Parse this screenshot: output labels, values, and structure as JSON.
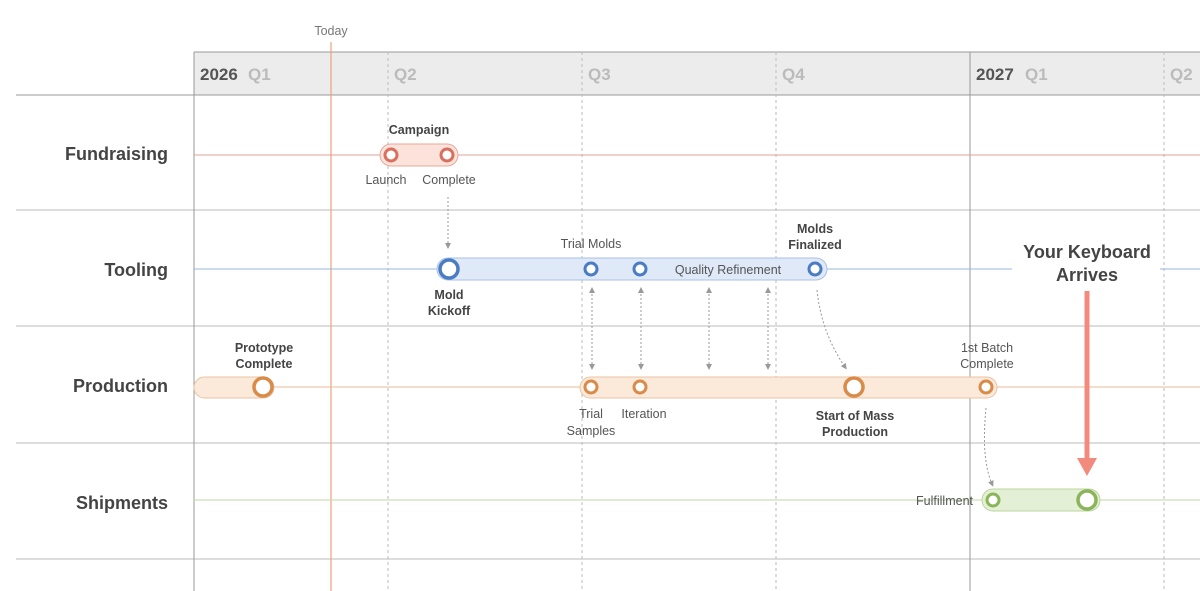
{
  "today": {
    "label": "Today"
  },
  "header": {
    "quarters": [
      {
        "year": "2026",
        "quarter": "Q1"
      },
      {
        "year": "",
        "quarter": "Q2"
      },
      {
        "year": "",
        "quarter": "Q3"
      },
      {
        "year": "",
        "quarter": "Q4"
      },
      {
        "year": "2027",
        "quarter": "Q1"
      },
      {
        "year": "",
        "quarter": "Q2"
      }
    ]
  },
  "lanes": [
    {
      "label": "Fundraising",
      "color": "#d9705e"
    },
    {
      "label": "Tooling",
      "color": "#4a7cc4"
    },
    {
      "label": "Production",
      "color": "#d98b4a"
    },
    {
      "label": "Shipments",
      "color": "#8bb55a"
    }
  ],
  "annotations": {
    "campaign": "Campaign",
    "launch": "Launch",
    "complete": "Complete",
    "trial_molds": "Trial Molds",
    "molds_finalized_1": "Molds",
    "molds_finalized_2": "Finalized",
    "mold_kickoff_1": "Mold",
    "mold_kickoff_2": "Kickoff",
    "quality_refinement": "Quality Refinement",
    "prototype_1": "Prototype",
    "prototype_2": "Complete",
    "first_batch_1": "1st Batch",
    "first_batch_2": "Complete",
    "trial_samples_1": "Trial",
    "trial_samples_2": "Samples",
    "iteration": "Iteration",
    "mass_production_1": "Start of Mass",
    "mass_production_2": "Production",
    "fulfillment": "Fulfillment",
    "keyboard_1": "Your Keyboard",
    "keyboard_2": "Arrives"
  },
  "colors": {
    "accent_arrow": "#f28b7e",
    "grid": "#cccccc",
    "header_bg": "#ececec",
    "today_line": "#e8a37a"
  }
}
